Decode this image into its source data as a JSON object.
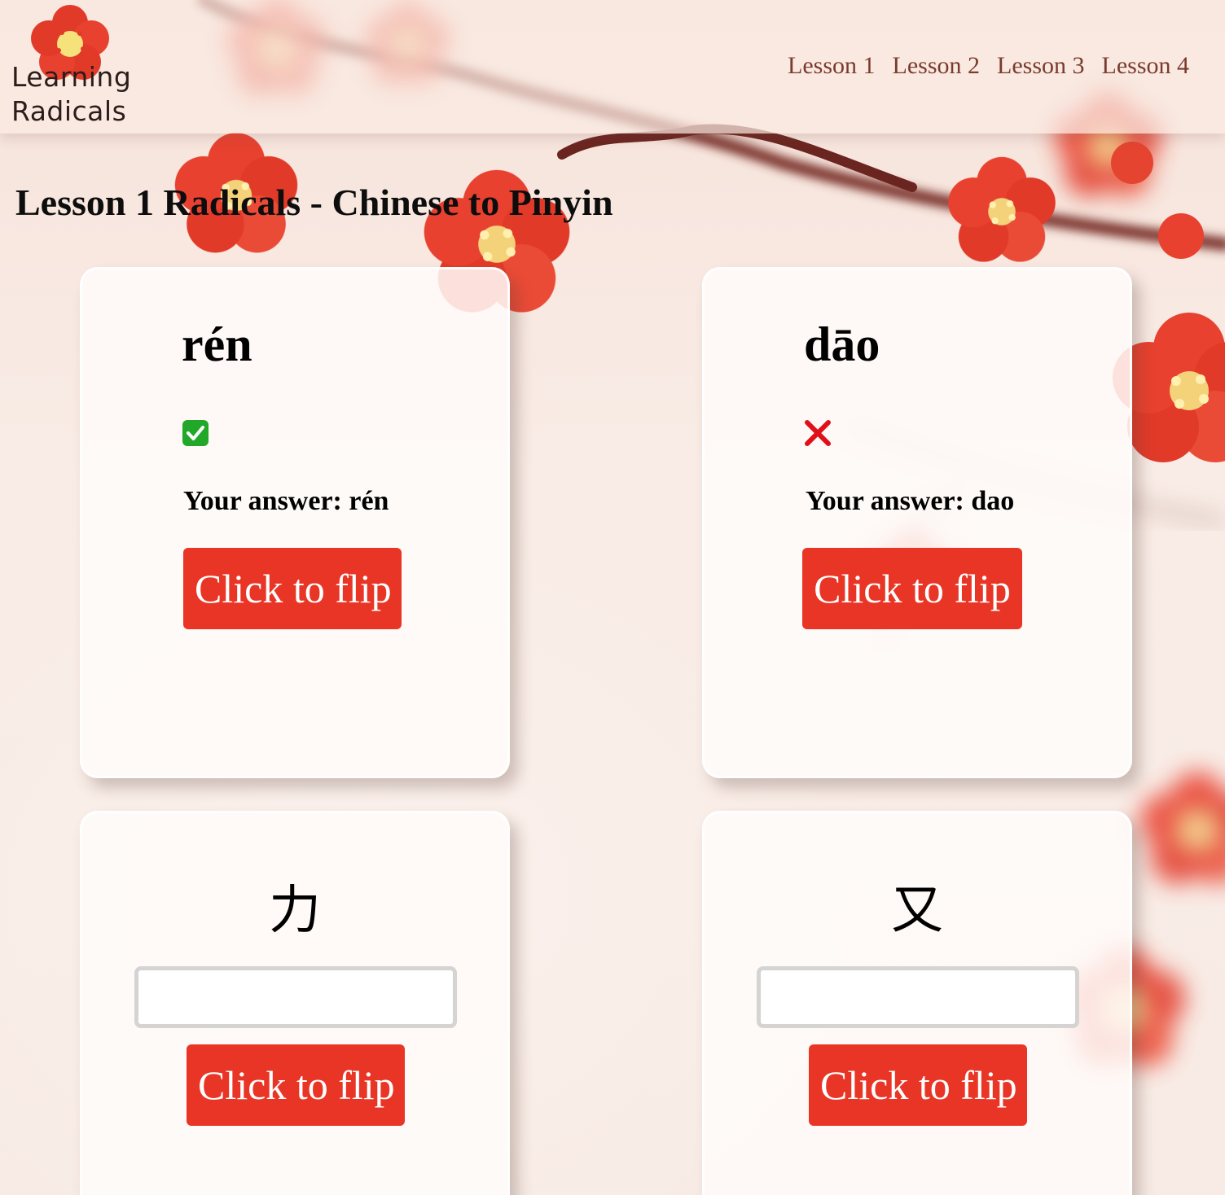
{
  "site": {
    "logo_line1": "Learning",
    "logo_line2": "Radicals"
  },
  "nav": {
    "items": [
      {
        "label": "Lesson 1"
      },
      {
        "label": "Lesson 2"
      },
      {
        "label": "Lesson 3"
      },
      {
        "label": "Lesson 4"
      }
    ]
  },
  "page": {
    "title": "Lesson 1 Radicals - Chinese to Pinyin"
  },
  "cards": [
    {
      "state": "answered-correct",
      "pinyin": "rén",
      "status_icon": "check-icon",
      "answer_text": "Your answer: rén",
      "flip_label": "Click to flip"
    },
    {
      "state": "answered-incorrect",
      "pinyin": "dāo",
      "status_icon": "cross-icon",
      "answer_text": "Your answer: dao",
      "flip_label": "Click to flip"
    },
    {
      "state": "unanswered",
      "hanzi": "力",
      "input_value": "",
      "flip_label": "Click to flip"
    },
    {
      "state": "unanswered",
      "hanzi": "又",
      "input_value": "",
      "flip_label": "Click to flip"
    }
  ],
  "colors": {
    "button_bg": "#e93526",
    "button_text": "#ffffff",
    "nav_link": "#7a3a2e",
    "correct": "#22a829",
    "incorrect": "#e0101a",
    "blossom": "#e8412f"
  }
}
